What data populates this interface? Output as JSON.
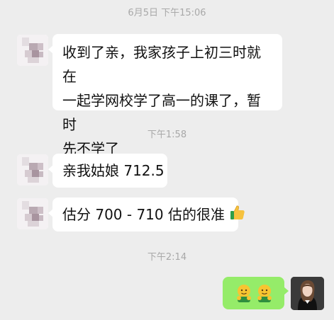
{
  "chat": {
    "timestamp_1": "6月5日 下午15:06",
    "message_1": "收到了亲，我家孩子上初三时就在一起学网校学了高一的课了，暂时先不学了",
    "message_1_lines": [
      "收到了亲，我家孩子上初三时就在",
      "一起学网校学了高一的课了，暂时",
      "先不学了"
    ],
    "timestamp_2": "下午1:58",
    "message_2": "亲我姑娘 712.5",
    "message_3": "估分 700 - 710 估的很准",
    "message_3_emoji": "thumbs-up-emoji",
    "timestamp_3": "下午2:14",
    "message_4_emojis": [
      "emoji-hands-face",
      "emoji-hands-face"
    ]
  },
  "colors": {
    "background": "#ededed",
    "incoming_bubble": "#ffffff",
    "outgoing_bubble": "#95ec69",
    "timestamp_text": "#a8a8a8"
  }
}
